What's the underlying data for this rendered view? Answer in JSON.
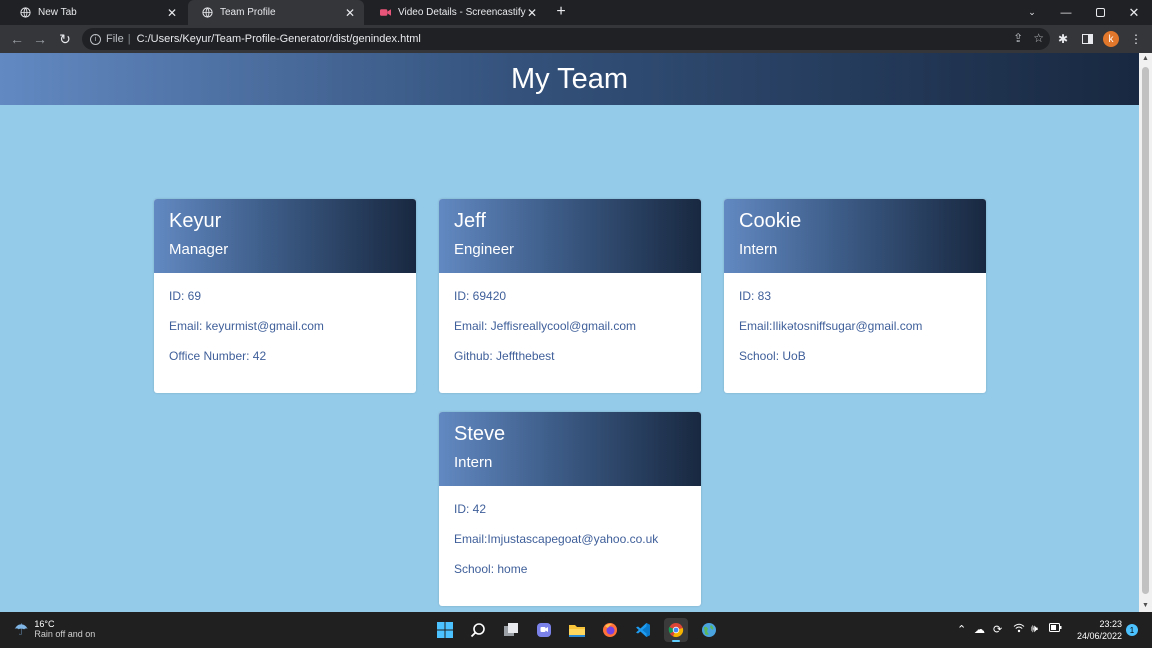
{
  "browser": {
    "tabs": [
      {
        "title": "New Tab",
        "icon": "globe-icon"
      },
      {
        "title": "Team Profile",
        "icon": "globe-icon",
        "active": true
      },
      {
        "title": "Video Details - Screencastify",
        "icon": "screencastify-icon"
      }
    ],
    "new_tab_symbol": "+",
    "address": {
      "scheme": "File",
      "separator": "|",
      "url": "C:/Users/Keyur/Team-Profile-Generator/dist/genindex.html"
    },
    "profile_initial": "k"
  },
  "page": {
    "title": "My Team",
    "employees": [
      {
        "name": "Keyur",
        "role": "Manager",
        "id_line": "ID: 69",
        "email_line": "Email: keyurmist@gmail.com",
        "extra_line": "Office Number: 42"
      },
      {
        "name": "Jeff",
        "role": "Engineer",
        "id_line": "ID: 69420",
        "email_line": "Email: Jeffisreallycool@gmail.com",
        "extra_line": "Github: Jeffthebest"
      },
      {
        "name": "Cookie",
        "role": "Intern",
        "id_line": "ID: 83",
        "email_line": "Email:Ilikətosniffsugar@gmail.com",
        "extra_line": "School: UoB"
      },
      {
        "name": "Steve",
        "role": "Intern",
        "id_line": "ID: 42",
        "email_line": "Email:Imjustascapegoat@yahoo.co.uk",
        "extra_line": "School: home"
      }
    ]
  },
  "taskbar": {
    "weather_temp": "16°C",
    "weather_desc": "Rain off and on",
    "time": "23:23",
    "date": "24/06/2022",
    "notification_count": "1"
  },
  "colors": {
    "page_background": "#94cbe8",
    "header_gradient_start": "#6289c2",
    "header_gradient_end": "#182840",
    "card_text": "#3f5f9a"
  }
}
